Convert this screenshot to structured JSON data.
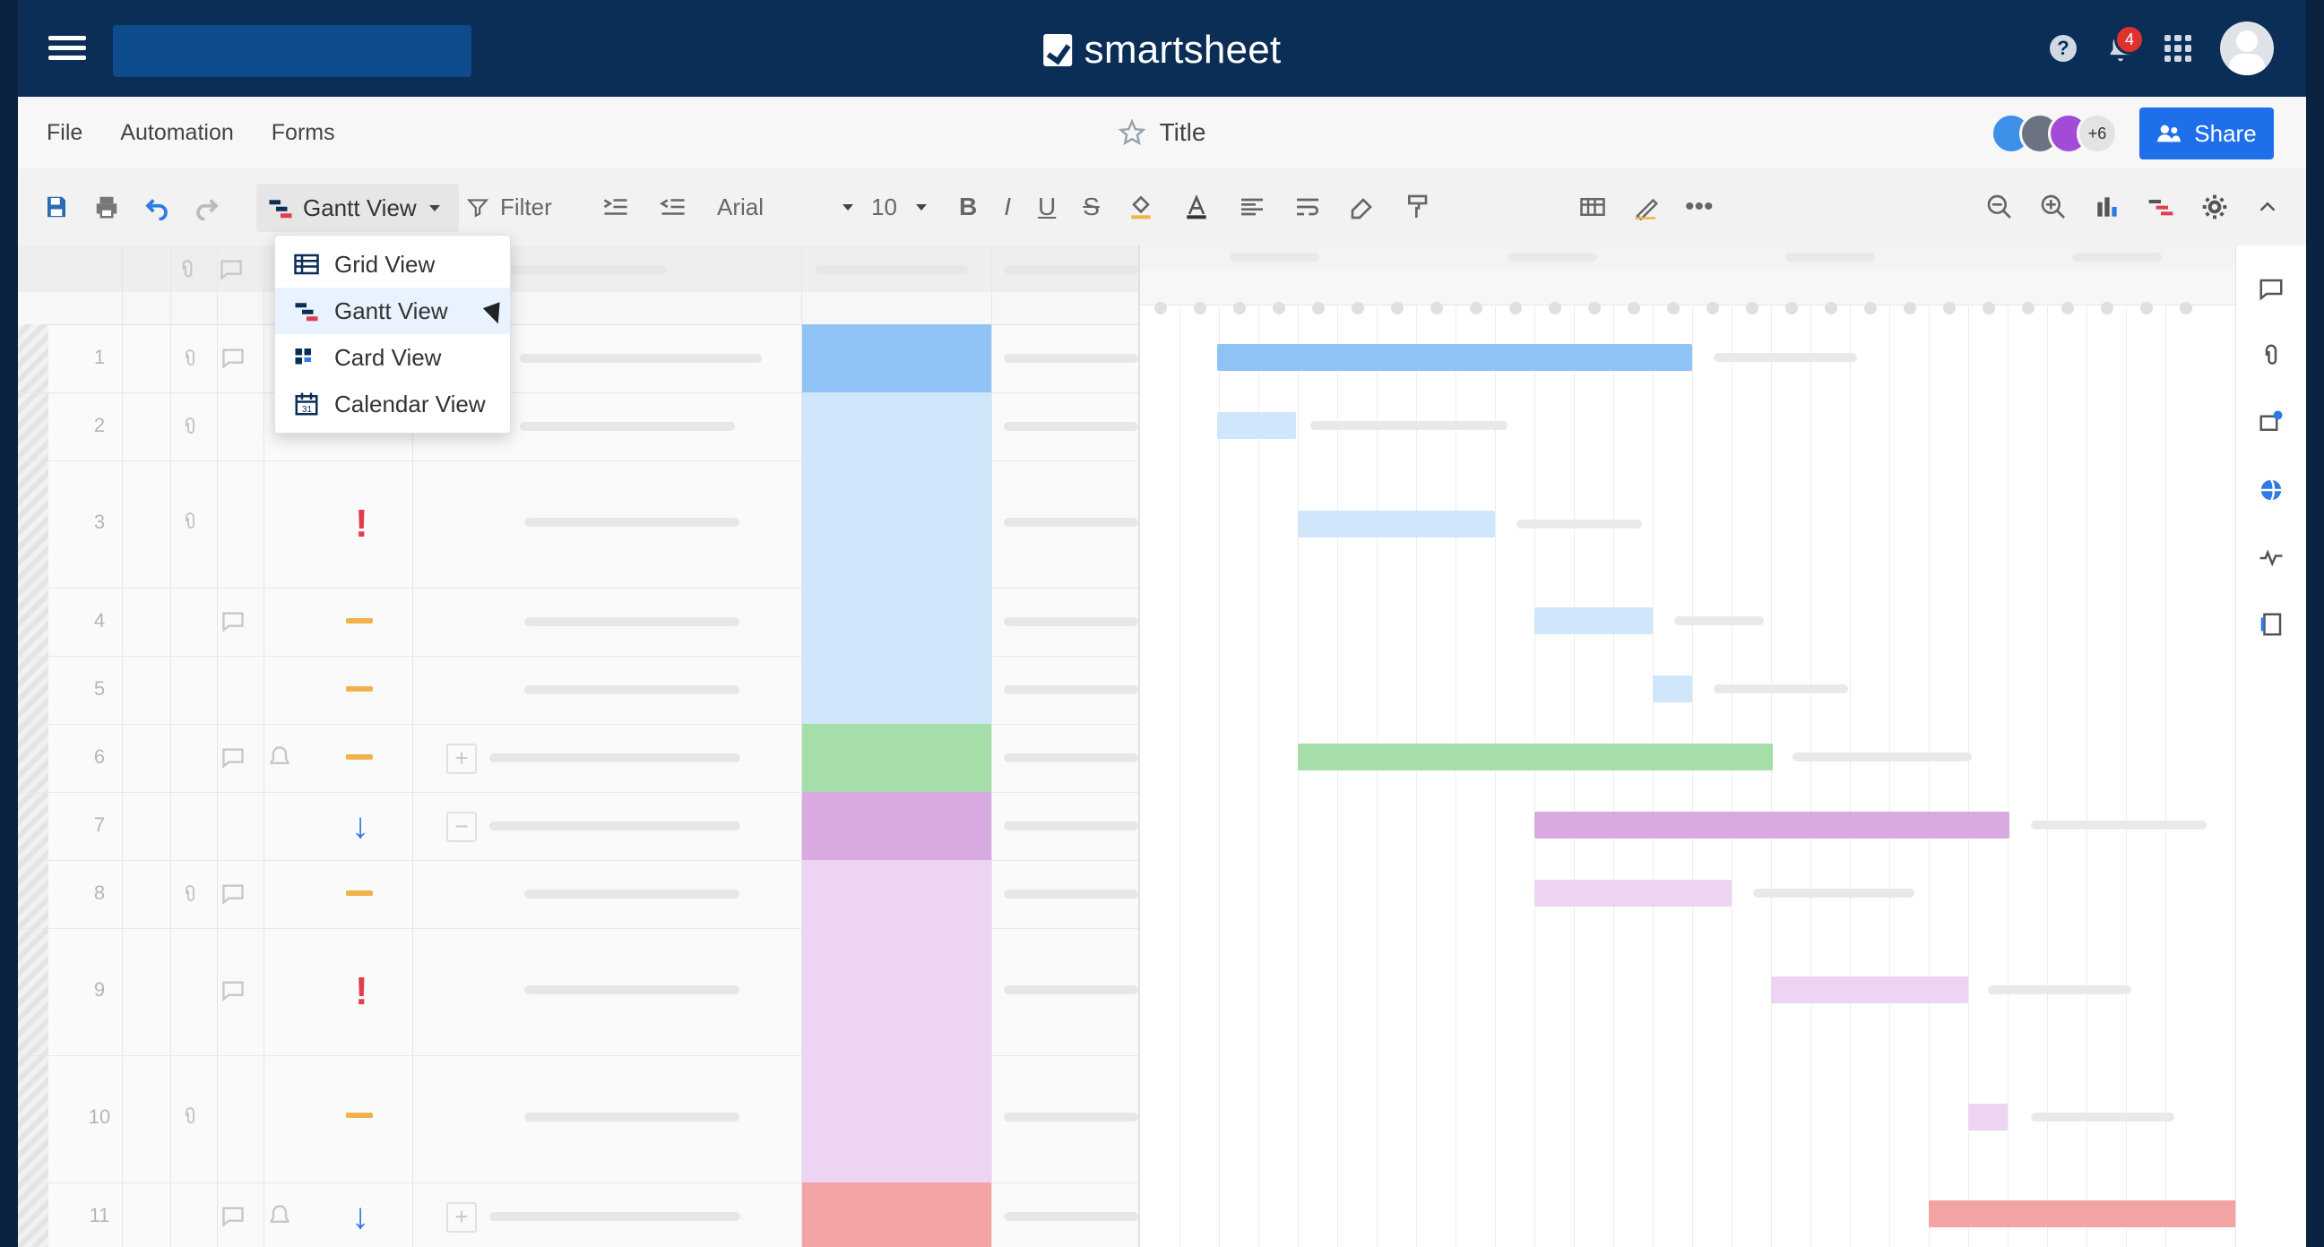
{
  "topbar": {
    "brand": "smartsheet",
    "notification_count": "4"
  },
  "menu": {
    "items": [
      "File",
      "Automation",
      "Forms"
    ],
    "title": "Title",
    "collaborators_more": "+6",
    "share_label": "Share"
  },
  "toolbar": {
    "view_label": "Gantt View",
    "filter_label": "Filter",
    "font_label": "Arial",
    "font_size_label": "10"
  },
  "dropdown": {
    "items": [
      {
        "label": "Grid View"
      },
      {
        "label": "Gantt View"
      },
      {
        "label": "Card View"
      },
      {
        "label": "Calendar View"
      }
    ]
  },
  "rows": [
    {
      "num": "1"
    },
    {
      "num": "2"
    },
    {
      "num": "3"
    },
    {
      "num": "4"
    },
    {
      "num": "5"
    },
    {
      "num": "6"
    },
    {
      "num": "7"
    },
    {
      "num": "8"
    },
    {
      "num": "9"
    },
    {
      "num": "10"
    },
    {
      "num": "11"
    }
  ],
  "colors": {
    "navy": "#0b2e57",
    "blue_dark": "#8fc3f5",
    "blue_light": "#cfe6fb",
    "green": "#a5dea8",
    "purple": "#d9a9e1",
    "purple_light": "#ecd4f2",
    "red": "#f3a3a3",
    "flag_red": "#e23d4f",
    "flag_orange": "#f2b24a",
    "arrow_blue": "#2f7ae5"
  }
}
